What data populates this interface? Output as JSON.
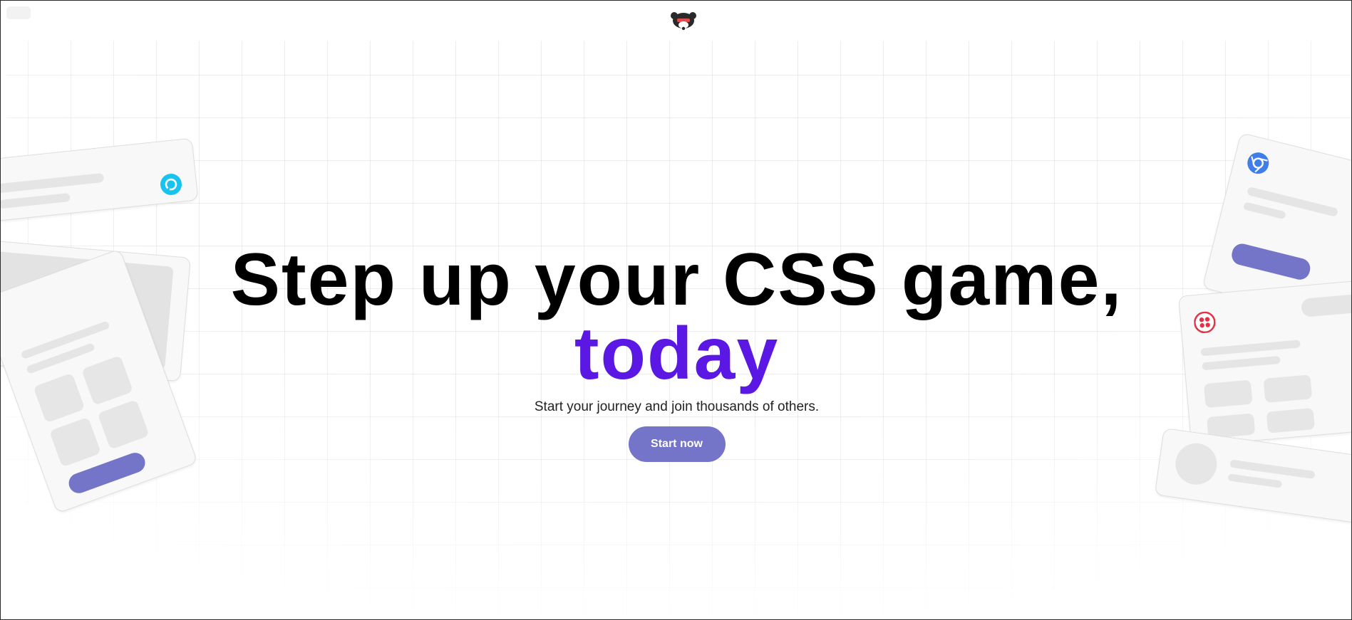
{
  "hero": {
    "headline": "Step up your CSS game,",
    "headline_accent": "today",
    "subtitle": "Start your journey and join thousands of others.",
    "cta_label": "Start now"
  },
  "colors": {
    "accent": "#5b17e3",
    "button": "#7474c8",
    "card_bg": "#f8f8f8",
    "placeholder": "#e5e5e5"
  },
  "icons": {
    "logo": "bear-mascot-logo",
    "card_icons": [
      "alexa-ring-icon",
      "chrome-icon",
      "twilio-icon"
    ]
  }
}
